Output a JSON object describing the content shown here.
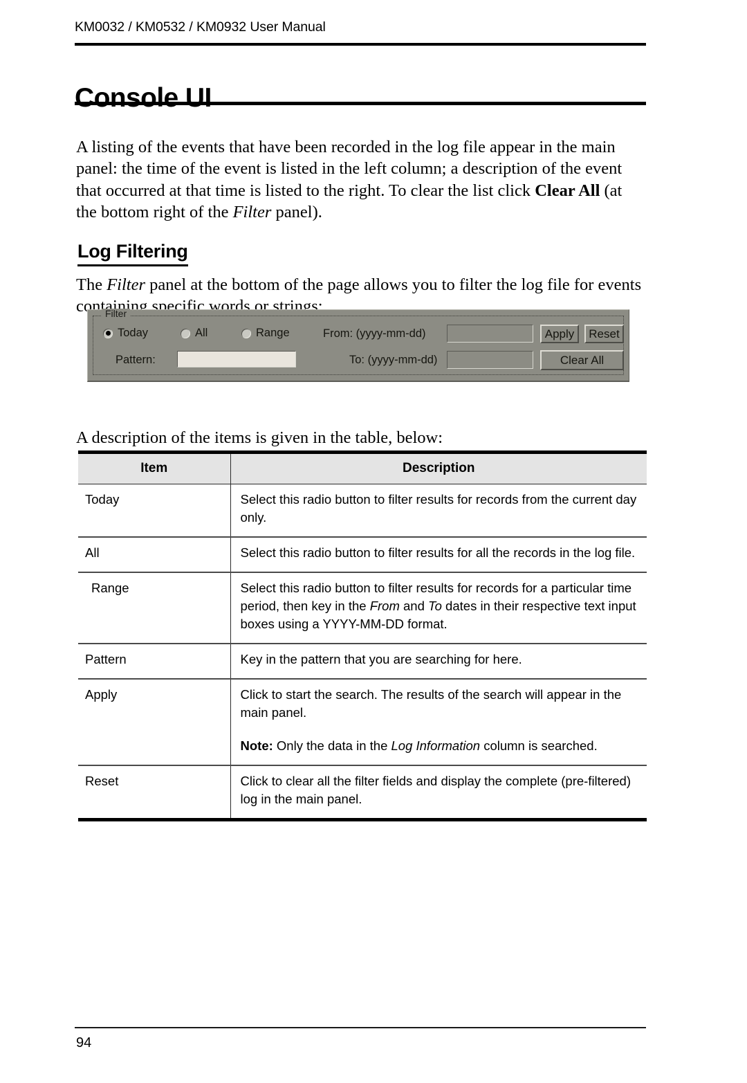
{
  "header": {
    "running_title": "KM0032 / KM0532 / KM0932 User Manual"
  },
  "chapter": {
    "title": "Console UI"
  },
  "paragraphs": {
    "intro_part1": "A listing of the events that have been recorded in the log file appear in the main panel: the time of the event is listed in the left column; a description of the event that occurred at that time is listed to the right. To clear the list click ",
    "intro_bold": "Clear All",
    "intro_part2": " (at the bottom right of the ",
    "intro_italic": "Filter",
    "intro_part3": " panel).",
    "filter_part1": "The ",
    "filter_italic": "Filter",
    "filter_part2": " panel at the bottom of the page allows you to filter the log file for events containing specific words or strings:",
    "table_intro": "A description of the items is given in the table, below:"
  },
  "section": {
    "heading": "Log Filtering"
  },
  "filter_panel": {
    "groupbox_label": "Filter",
    "radios": [
      {
        "label": "Today",
        "selected": true
      },
      {
        "label": "All",
        "selected": false
      },
      {
        "label": "Range",
        "selected": false
      }
    ],
    "pattern_label": "Pattern:",
    "pattern_value": "",
    "from_label": "From: (yyyy-mm-dd)",
    "from_value": "",
    "to_label": "To: (yyyy-mm-dd)",
    "to_value": "",
    "buttons": {
      "apply": "Apply",
      "reset": "Reset",
      "clear_all": "Clear All"
    },
    "colors": {
      "face": "#8c8c84",
      "field": "#e9e5dd",
      "text": "#15150f"
    }
  },
  "table": {
    "headers": {
      "item": "Item",
      "description": "Description"
    },
    "rows": [
      {
        "item": "Today",
        "indent": false,
        "desc_parts": [
          {
            "text": "Select this radio button to filter results for records from the current day only.",
            "style": "normal"
          }
        ],
        "note": null
      },
      {
        "item": "All",
        "indent": false,
        "desc_parts": [
          {
            "text": "Select this radio button to filter results for all the records in the log file.",
            "style": "normal"
          }
        ],
        "note": null
      },
      {
        "item": "Range",
        "indent": true,
        "desc_parts": [
          {
            "text": "Select this radio button to filter results for records for a particular time period, then key in the ",
            "style": "normal"
          },
          {
            "text": "From",
            "style": "italic"
          },
          {
            "text": " and ",
            "style": "normal"
          },
          {
            "text": "To",
            "style": "italic"
          },
          {
            "text": " dates in their respective text input boxes using a YYYY-MM-DD format.",
            "style": "normal"
          }
        ],
        "note": null
      },
      {
        "item": "Pattern",
        "indent": false,
        "desc_parts": [
          {
            "text": "Key in the pattern that you are searching for here.",
            "style": "normal"
          }
        ],
        "note": null
      },
      {
        "item": "Apply",
        "indent": false,
        "desc_parts": [
          {
            "text": "Click to start the search. The results of the search will appear in the main panel.",
            "style": "normal"
          }
        ],
        "note": [
          {
            "text": "Note:",
            "style": "bold"
          },
          {
            "text": " Only the data in the ",
            "style": "normal"
          },
          {
            "text": "Log Information",
            "style": "italic"
          },
          {
            "text": " column is searched.",
            "style": "normal"
          }
        ]
      },
      {
        "item": "Reset",
        "indent": false,
        "desc_parts": [
          {
            "text": "Click to clear all the filter fields and display the complete (pre-filtered) log in the main panel.",
            "style": "normal"
          }
        ],
        "note": null
      }
    ]
  },
  "footer": {
    "page_number": "94"
  }
}
